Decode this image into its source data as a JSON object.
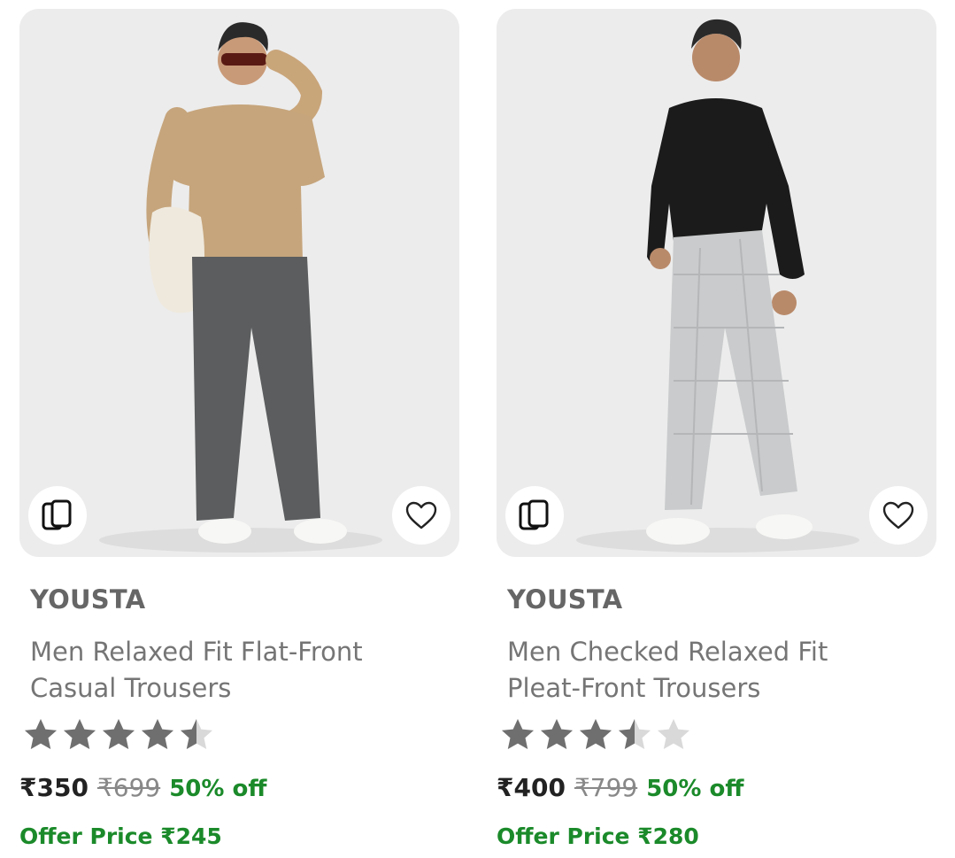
{
  "products": [
    {
      "brand": "YOUSTA",
      "title_line1": "Men Relaxed Fit Flat-Front",
      "title_line2": "Casual Trousers",
      "rating": 4.5,
      "price": "₹350",
      "mrp": "₹699",
      "discount": "50% off",
      "offer_price": "Offer Price ₹245",
      "image_desc": "model-beige-sweater-grey-trousers"
    },
    {
      "brand": "YOUSTA",
      "title_line1": "Men Checked Relaxed Fit",
      "title_line2": "Pleat-Front Trousers",
      "rating": 3.5,
      "price": "₹400",
      "mrp": "₹799",
      "discount": "50% off",
      "offer_price": "Offer Price ₹280",
      "image_desc": "model-black-shirt-light-grey-check-trousers"
    }
  ],
  "icons": {
    "similar": "similar-products-icon",
    "wishlist": "heart-icon",
    "star": "star-icon"
  },
  "colors": {
    "offer_green": "#1b8a2a",
    "star_filled": "#6f6f6f",
    "star_empty": "#d9d9d9"
  }
}
